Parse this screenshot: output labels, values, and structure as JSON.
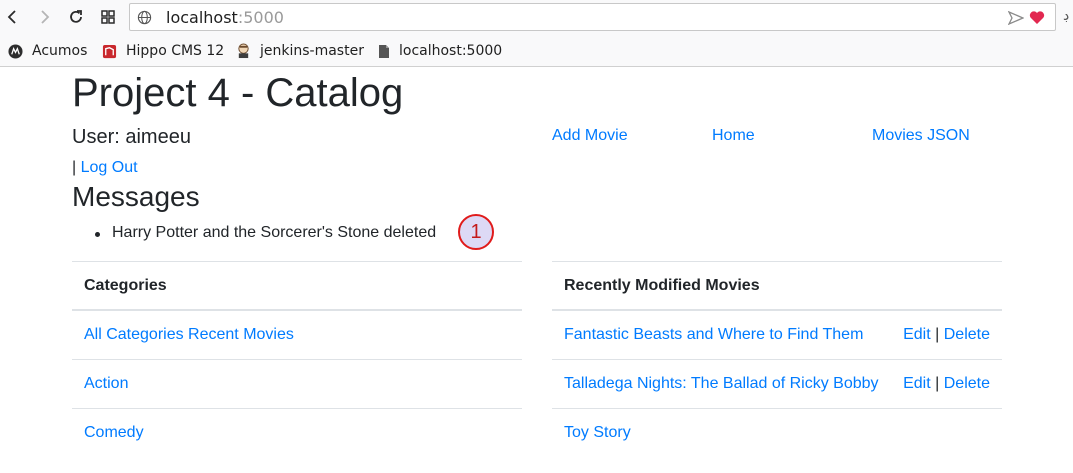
{
  "browser": {
    "url_host": "localhost",
    "url_port": ":5000",
    "edge_glyph": "ڊ",
    "bookmarks": [
      {
        "label": "Acumos",
        "icon": "acumos-icon"
      },
      {
        "label": "Hippo CMS 12",
        "icon": "hippo-cms-icon"
      },
      {
        "label": "jenkins-master",
        "icon": "jenkins-icon"
      },
      {
        "label": "localhost:5000",
        "icon": "page-icon"
      }
    ],
    "heart_color": "#e22850"
  },
  "page": {
    "title": "Project 4 - Catalog",
    "user_label": "User: aimeeu",
    "nav": {
      "add_movie": "Add Movie",
      "home": "Home",
      "movies_json": "Movies JSON"
    },
    "separator": "|",
    "logout": "Log Out",
    "messages_title": "Messages",
    "messages": [
      "Harry Potter and the Sorcerer's Stone deleted"
    ],
    "marker": "1",
    "link_color": "#007bff"
  },
  "categories_table": {
    "header": "Categories",
    "rows": [
      "All Categories Recent Movies",
      "Action",
      "Comedy"
    ]
  },
  "movies_table": {
    "header": "Recently Modified Movies",
    "rows": [
      {
        "title": "Fantastic Beasts and Where to Find Them",
        "edit": "Edit",
        "sep": "|",
        "delete": "Delete"
      },
      {
        "title": "Talladega Nights: The Ballad of Ricky Bobby",
        "edit": "Edit",
        "sep": "|",
        "delete": "Delete"
      },
      {
        "title": "Toy Story"
      }
    ]
  }
}
